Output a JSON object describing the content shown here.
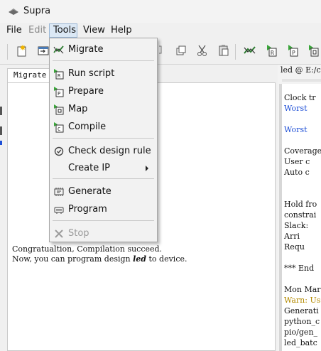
{
  "app": {
    "title": "Supra"
  },
  "menubar": {
    "items": [
      {
        "label": "File",
        "enabled": true
      },
      {
        "label": "Edit",
        "enabled": false
      },
      {
        "label": "Tools",
        "enabled": true,
        "open": true
      },
      {
        "label": "View",
        "enabled": true
      },
      {
        "label": "Help",
        "enabled": true
      }
    ]
  },
  "tools_menu": {
    "items": [
      {
        "label": "Migrate",
        "icon": "migrate-icon",
        "enabled": true
      },
      {
        "label": "Run script",
        "icon": "run-script-icon",
        "enabled": true
      },
      {
        "label": "Prepare",
        "icon": "prepare-icon",
        "enabled": true
      },
      {
        "label": "Map",
        "icon": "map-icon",
        "enabled": true
      },
      {
        "label": "Compile",
        "icon": "compile-icon",
        "enabled": true
      },
      {
        "label": "Check design rule",
        "icon": "check-design-rule-icon",
        "enabled": true
      },
      {
        "label": "Create IP",
        "icon": "",
        "enabled": true,
        "submenu": true
      },
      {
        "label": "Generate",
        "icon": "generate-icon",
        "enabled": true
      },
      {
        "label": "Program",
        "icon": "program-icon",
        "enabled": true
      },
      {
        "label": "Stop",
        "icon": "stop-icon",
        "enabled": false
      }
    ]
  },
  "left_panel": {
    "tab_label": "Migrate",
    "console": {
      "line1": "Congratualtion, Compilation succeed.",
      "line2_prefix": "Now, you can program design ",
      "line2_design": "led",
      "line2_suffix": " to device."
    }
  },
  "right_panel": {
    "tab_label": "led @ E:/c",
    "lines": [
      {
        "text": "Clock tr",
        "style": "normal"
      },
      {
        "text": "  Worst",
        "style": "blue"
      },
      {
        "text": "  Worst",
        "style": "blue"
      },
      {
        "text": "Coverage",
        "style": "normal"
      },
      {
        "text": "  User c",
        "style": "normal"
      },
      {
        "text": "  Auto c",
        "style": "normal"
      },
      {
        "text": "Hold fro",
        "style": "normal"
      },
      {
        "text": "constrai",
        "style": "normal"
      },
      {
        "text": "  Slack:",
        "style": "normal"
      },
      {
        "text": "    Arri",
        "style": "normal"
      },
      {
        "text": "    Requ",
        "style": "normal"
      },
      {
        "text": "*** End",
        "style": "normal"
      },
      {
        "text": "Mon Mar",
        "style": "normal"
      },
      {
        "text": "Warn: Us",
        "style": "warn"
      },
      {
        "text": "Generati",
        "style": "normal"
      },
      {
        "text": "python_c",
        "style": "normal"
      },
      {
        "text": "pio/gen_",
        "style": "normal"
      },
      {
        "text": "led_batc",
        "style": "normal"
      }
    ]
  },
  "colors": {
    "accent_green": "#3aa63a",
    "console_blue": "#1e4fd6",
    "warn_yellow": "#b38a00",
    "menu_highlight": "#dbe8f5"
  }
}
